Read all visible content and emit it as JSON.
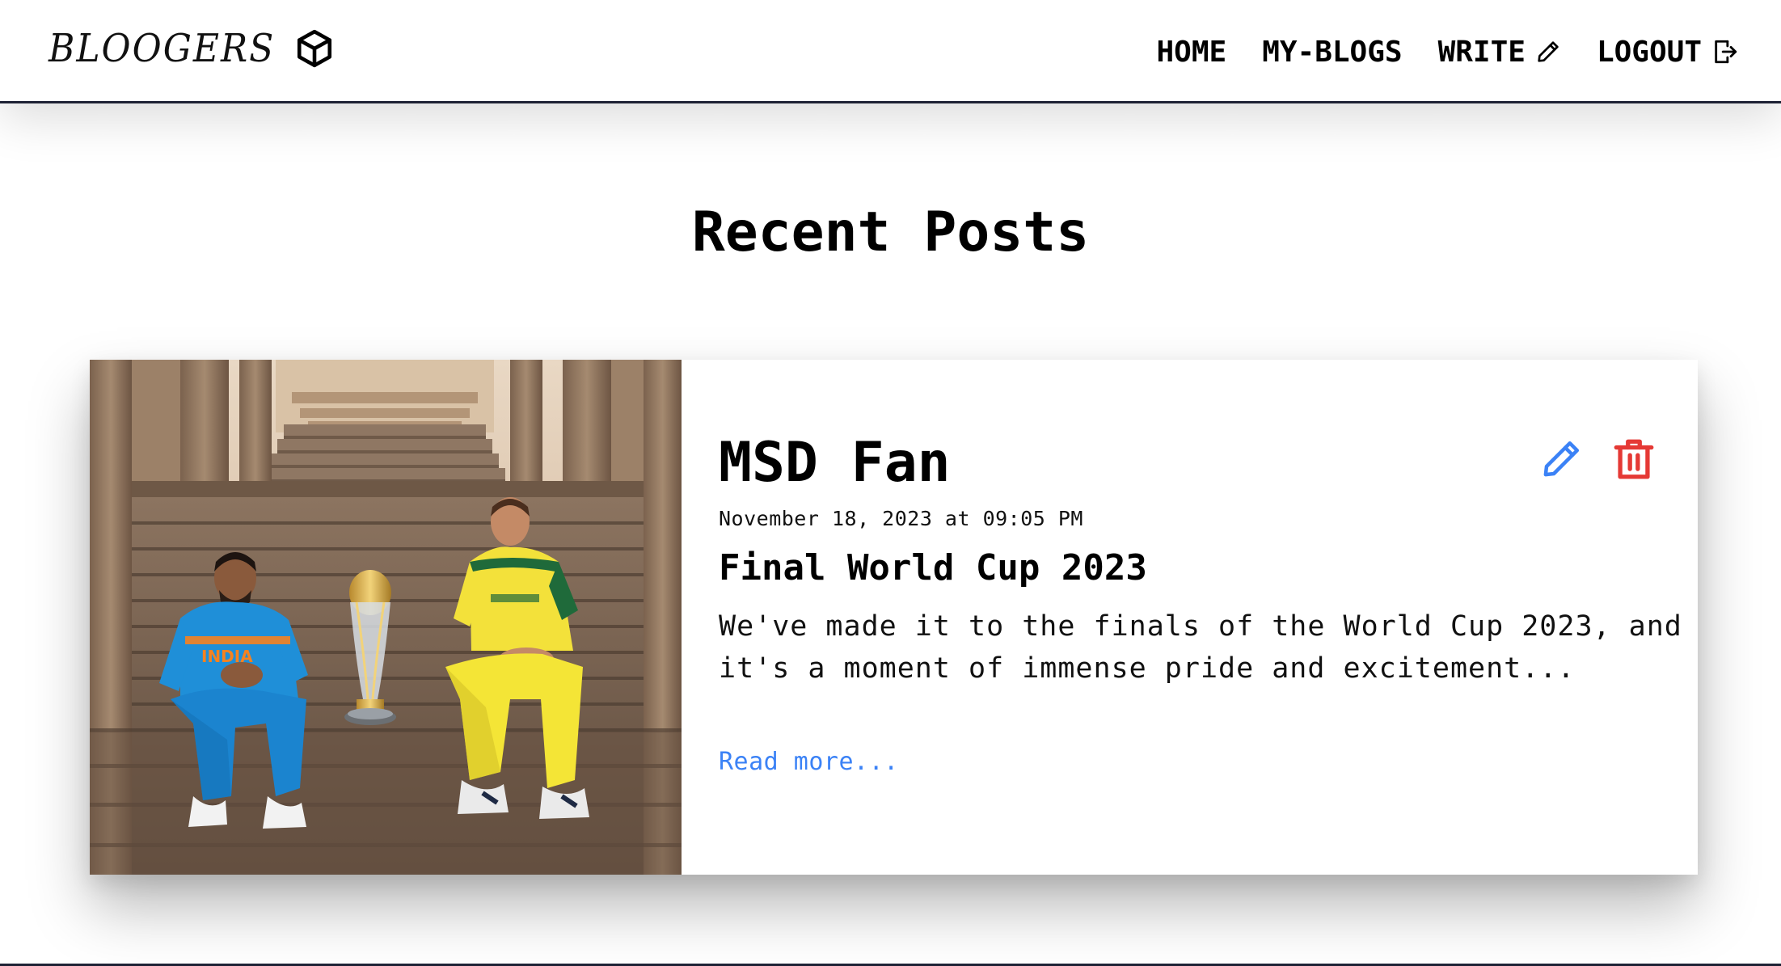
{
  "header": {
    "brand": "BLOOGERS",
    "brand_icon": "cube-icon",
    "nav": [
      {
        "label": "HOME",
        "icon": null
      },
      {
        "label": "MY-BLOGS",
        "icon": null
      },
      {
        "label": "WRITE",
        "icon": "pencil-icon"
      },
      {
        "label": "LOGOUT",
        "icon": "logout-icon"
      }
    ]
  },
  "main": {
    "title": "Recent Posts",
    "posts": [
      {
        "author": "MSD Fan",
        "date": "November 18, 2023 at 09:05 PM",
        "title": "Final World Cup 2023",
        "excerpt": "We've made it to the finals of the World Cup 2023, and it's a moment of immense pride and excitement...",
        "read_more": "Read more...",
        "image_label": "INDIA",
        "image_alt": "Two cricket captains seated on stepwell stairs beside the World Cup trophy",
        "actions": {
          "edit_icon": "pencil-icon",
          "delete_icon": "trash-icon"
        }
      }
    ]
  },
  "colors": {
    "link": "#3b82f6",
    "edit": "#3b82f6",
    "delete": "#e53935",
    "rule": "#1e2235"
  }
}
